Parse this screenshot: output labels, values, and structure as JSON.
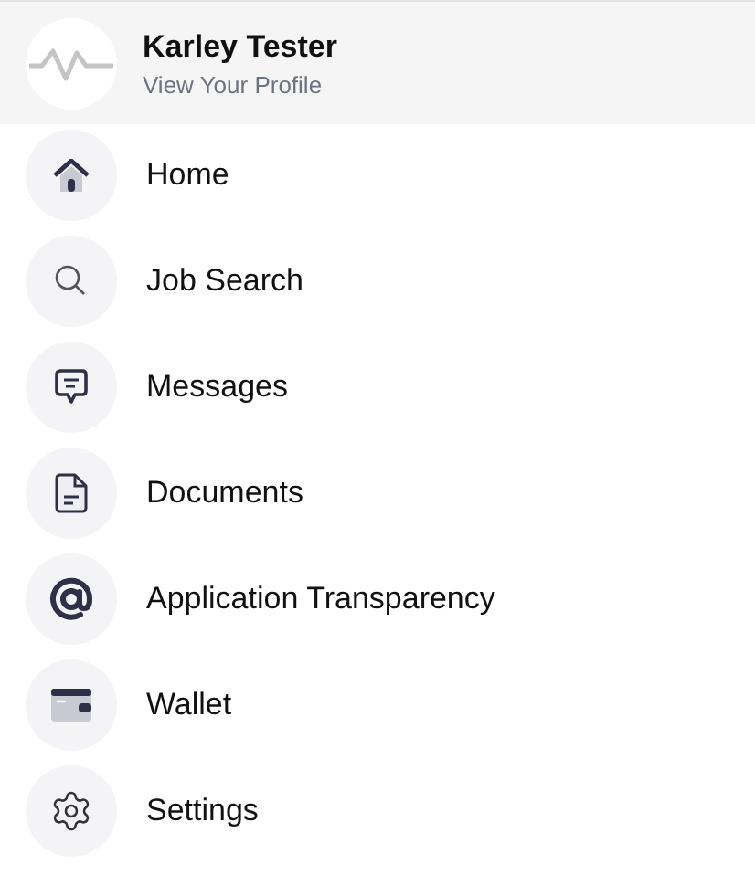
{
  "profile": {
    "name": "Karley Tester",
    "link": "View Your Profile"
  },
  "menu": [
    {
      "kind": "home",
      "label": "Home"
    },
    {
      "kind": "search",
      "label": "Job Search"
    },
    {
      "kind": "messages",
      "label": "Messages"
    },
    {
      "kind": "documents",
      "label": "Documents"
    },
    {
      "kind": "at",
      "label": "Application Transparency"
    },
    {
      "kind": "wallet",
      "label": "Wallet"
    },
    {
      "kind": "settings",
      "label": "Settings"
    }
  ]
}
